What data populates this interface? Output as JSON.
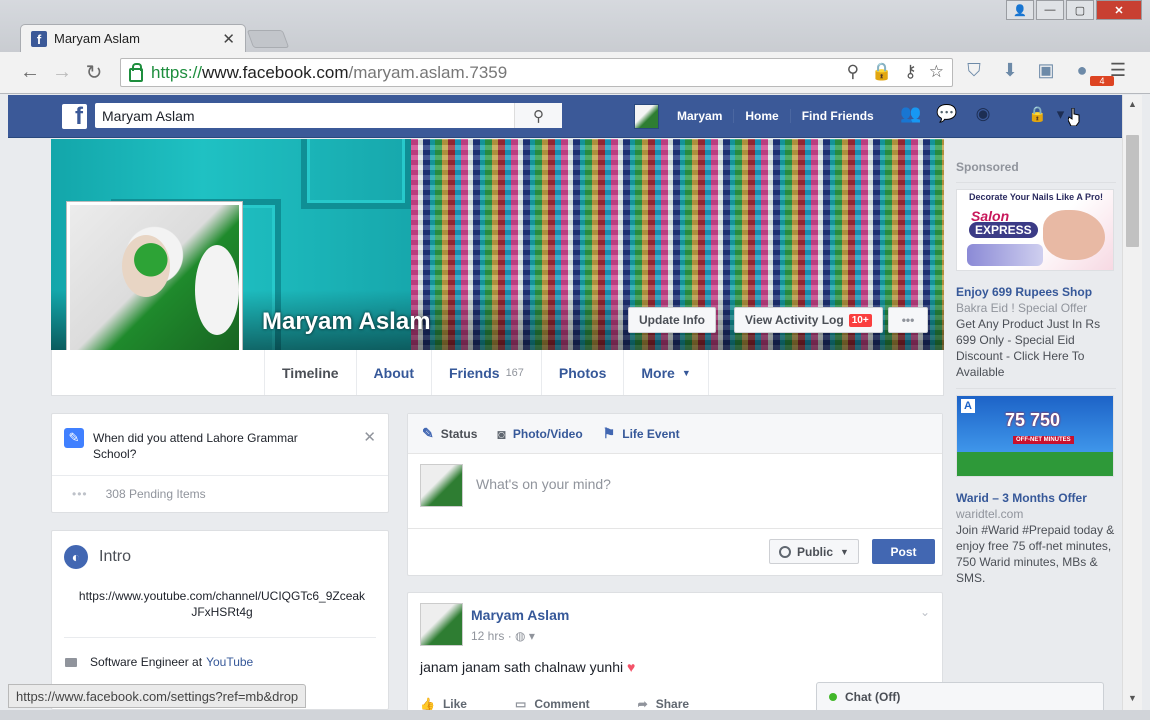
{
  "browser": {
    "tab_title": "Maryam Aslam",
    "url_scheme": "https://",
    "url_host": "www.facebook.com",
    "url_path": "/maryam.aslam.7359",
    "extension_badge": "4",
    "status_url": "https://www.facebook.com/settings?ref=mb&drop"
  },
  "fb_header": {
    "search_value": "Maryam Aslam",
    "nav": [
      "Maryam",
      "Home",
      "Find Friends"
    ]
  },
  "profile": {
    "name": "Maryam Aslam",
    "update_info": "Update Info",
    "view_activity_log": "View Activity Log",
    "activity_badge": "10+",
    "more_dots": "•••",
    "tabs": {
      "timeline": "Timeline",
      "about": "About",
      "friends": "Friends",
      "friends_count": "167",
      "photos": "Photos",
      "more": "More"
    }
  },
  "question_card": {
    "question": "When did you attend Lahore Grammar School?",
    "pending": "308 Pending Items"
  },
  "intro": {
    "title": "Intro",
    "link": "https://www.youtube.com/channel/UCIQGTc6_9ZceakJFxHSRt4g",
    "work_prefix": "Software Engineer at",
    "work_company": "YouTube"
  },
  "composer": {
    "tabs": [
      "Status",
      "Photo/Video",
      "Life Event"
    ],
    "placeholder": "What's on your mind?",
    "privacy": "Public",
    "post_button": "Post"
  },
  "post": {
    "author": "Maryam Aslam",
    "time": "12 hrs",
    "text": "janam janam sath chalnaw yunhi",
    "actions": [
      "Like",
      "Comment",
      "Share"
    ]
  },
  "sidebar": {
    "sponsored_label": "Sponsored",
    "ads": [
      {
        "image_head": "Decorate Your Nails Like A Pro!",
        "image_brand": "Salon",
        "image_brand2": "EXPRESS",
        "title": "Enjoy 699 Rupees Shop",
        "subtitle": "Bakra Eid ! Special Offer",
        "body": "Get Any Product Just In Rs 699 Only - Special Eid Discount - Click Here To Available"
      },
      {
        "image_big": "75 750",
        "image_tag": "OFF-NET MINUTES",
        "title": "Warid – 3 Months Offer",
        "subtitle": "waridtel.com",
        "body": "Join #Warid #Prepaid today & enjoy free 75 off-net minutes, 750 Warid minutes, MBs & SMS."
      }
    ]
  },
  "chat": {
    "label": "Chat (Off)"
  },
  "colors": {
    "fb_blue": "#3b5998",
    "link_blue": "#365899",
    "post_button": "#4267b2",
    "badge_red": "#fa3e3e",
    "chat_online": "#42b72a",
    "secure_green": "#1e8e3e"
  },
  "icons": [
    "facebook-favicon",
    "tab-close-icon",
    "back-icon",
    "forward-icon",
    "reload-icon",
    "secure-lock-icon",
    "zoom-icon",
    "star-icon",
    "menu-icon",
    "search-icon",
    "friend-requests-icon",
    "messages-icon",
    "notifications-icon",
    "privacy-shortcuts-icon",
    "account-menu-icon",
    "pencil-icon",
    "camera-icon",
    "flag-icon",
    "globe-icon",
    "briefcase-icon",
    "like-icon",
    "comment-icon",
    "share-icon"
  ]
}
